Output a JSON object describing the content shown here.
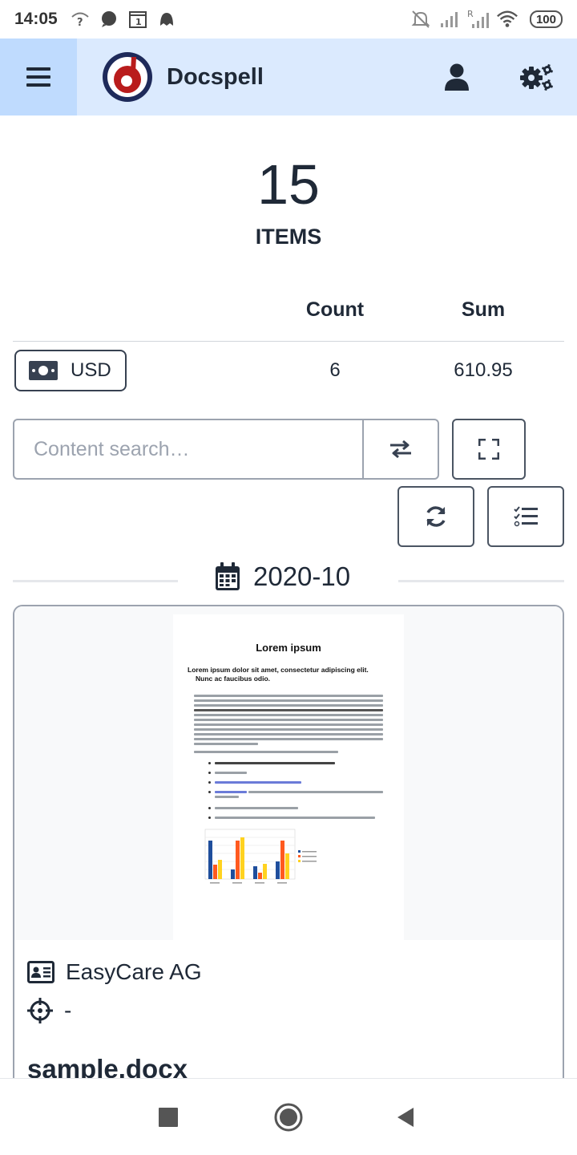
{
  "status_bar": {
    "time": "14:05",
    "battery": "100",
    "left_icons": [
      "wifi-question-icon",
      "chat-bubble-icon",
      "calendar-one-icon",
      "octopus-icon"
    ],
    "right_icons": [
      "bell-off-icon",
      "signal-icon",
      "signal-r-icon",
      "wifi-icon"
    ]
  },
  "app_bar": {
    "title": "Docspell",
    "brand_color": "#1e2a5a",
    "accent_color": "#b91c1c",
    "bg_color": "#dbeafe",
    "menu_bg": "#bfdbfe"
  },
  "summary": {
    "count": "15",
    "label": "ITEMS",
    "columns": {
      "count": "Count",
      "sum": "Sum"
    },
    "rows": [
      {
        "currency": "USD",
        "count": "6",
        "sum": "610.95"
      }
    ]
  },
  "search": {
    "placeholder": "Content search…",
    "value": ""
  },
  "group": {
    "date": "2020-10"
  },
  "card": {
    "preview": {
      "title": "Lorem ipsum",
      "heading_line1": "Lorem ipsum dolor sit amet, consectetur adipiscing elit.",
      "heading_line2": "Nunc ac faucibus odio."
    },
    "correspondent": "EasyCare AG",
    "concerning": "-",
    "name": "sample.docx"
  },
  "nav": {
    "items": [
      "recent-apps",
      "home",
      "back"
    ]
  }
}
